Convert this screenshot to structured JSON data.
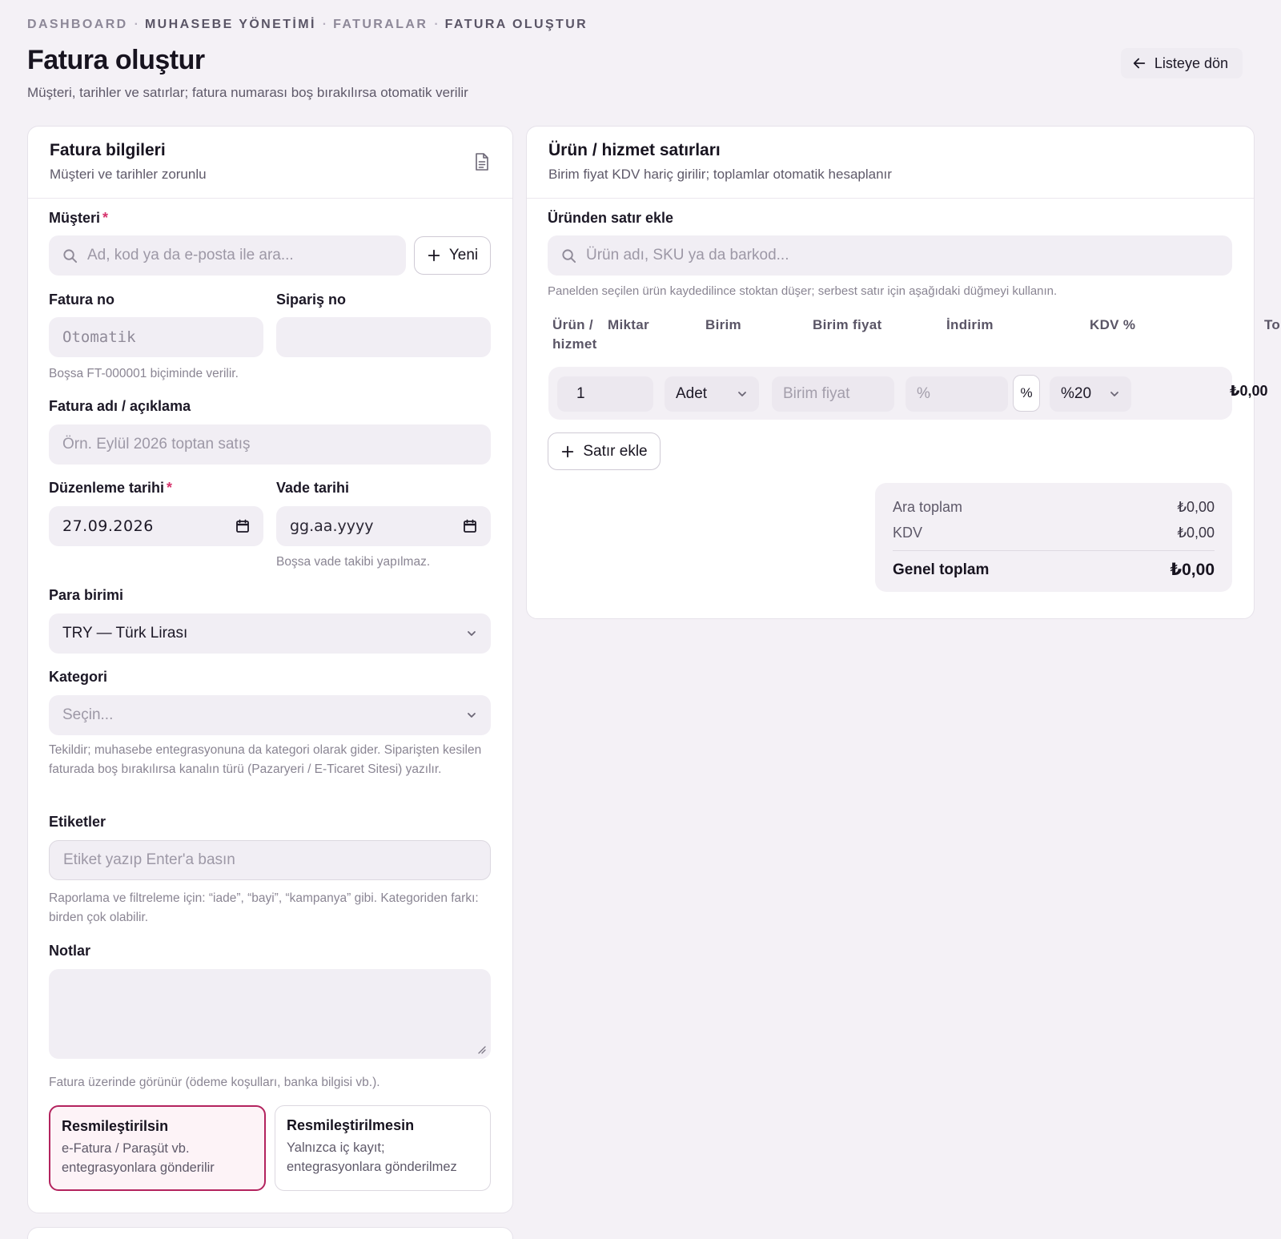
{
  "breadcrumb": {
    "items": [
      "DASHBOARD",
      "MUHASEBE YÖNETİMİ",
      "FATURALAR",
      "FATURA OLUŞTUR"
    ],
    "separator": "·"
  },
  "page": {
    "title": "Fatura oluştur",
    "subtitle": "Müşteri, tarihler ve satırlar; fatura numarası boş bırakılırsa otomatik verilir",
    "back_label": "Listeye dön"
  },
  "invoice_info": {
    "title": "Fatura bilgileri",
    "subtitle": "Müşteri ve tarihler zorunlu",
    "customer": {
      "label": "Müşteri",
      "required_mark": "*",
      "placeholder": "Ad, kod ya da e-posta ile ara...",
      "new_label": "Yeni"
    },
    "invoice_no": {
      "label": "Fatura no",
      "placeholder": "Otomatik",
      "help": "Boşsa FT-000001 biçiminde verilir."
    },
    "order_no": {
      "label": "Sipariş no",
      "value": ""
    },
    "description": {
      "label": "Fatura adı / açıklama",
      "placeholder": "Örn. Eylül 2026 toptan satış"
    },
    "issue_date": {
      "label": "Düzenleme tarihi",
      "required_mark": "*",
      "value": "27.09.2026"
    },
    "due_date": {
      "label": "Vade tarihi",
      "placeholder": "gg.aa.yyyy",
      "help": "Boşsa vade takibi yapılmaz."
    },
    "currency": {
      "label": "Para birimi",
      "value": "TRY — Türk Lirası"
    },
    "category": {
      "label": "Kategori",
      "placeholder": "Seçin...",
      "help": "Tekildir; muhasebe entegrasyonuna da kategori olarak gider. Siparişten kesilen faturada boş bırakılırsa kanalın türü (Pazaryeri / E-Ticaret Sitesi) yazılır."
    },
    "tags": {
      "label": "Etiketler",
      "placeholder": "Etiket yazıp Enter'a basın",
      "help": "Raporlama ve filtreleme için: “iade”, “bayi”, “kampanya” gibi. Kategoriden farkı: birden çok olabilir."
    },
    "notes": {
      "label": "Notlar",
      "help": "Fatura üzerinde görünür (ödeme koşulları, banka bilgisi vb.)."
    },
    "official": {
      "yes_title": "Resmileştirilsin",
      "yes_desc": "e-Fatura / Paraşüt vb. entegrasyonlara gönderilir",
      "no_title": "Resmileştirilmesin",
      "no_desc": "Yalnızca iç kayıt; entegrasyonlara gönderilmez"
    }
  },
  "lines": {
    "title": "Ürün / hizmet satırları",
    "subtitle": "Birim fiyat KDV hariç girilir; toplamlar otomatik hesaplanır",
    "add_from_product_label": "Üründen satır ekle",
    "product_search_placeholder": "Ürün adı, SKU ya da barkod...",
    "help": "Panelden seçilen ürün kaydedilince stoktan düşer; serbest satır için aşağıdaki düğmeyi kullanın.",
    "columns": [
      "Ürün / hizmet",
      "Miktar",
      "Birim",
      "Birim fiyat",
      "İndirim",
      "KDV %",
      "To"
    ],
    "row": {
      "quantity": "1",
      "unit": "Adet",
      "unit_price_placeholder": "Birim fiyat",
      "discount_placeholder": "%",
      "discount_type": "%",
      "vat": "%20",
      "total": "₺0,00"
    },
    "add_row_label": "Satır ekle",
    "totals": {
      "subtotal_label": "Ara toplam",
      "subtotal": "₺0,00",
      "vat_label": "KDV",
      "vat": "₺0,00",
      "grand_label": "Genel toplam",
      "grand": "₺0,00"
    }
  },
  "colors": {
    "accent": "#b3235e",
    "required": "#d6336c",
    "background": "#f4f1f6"
  }
}
